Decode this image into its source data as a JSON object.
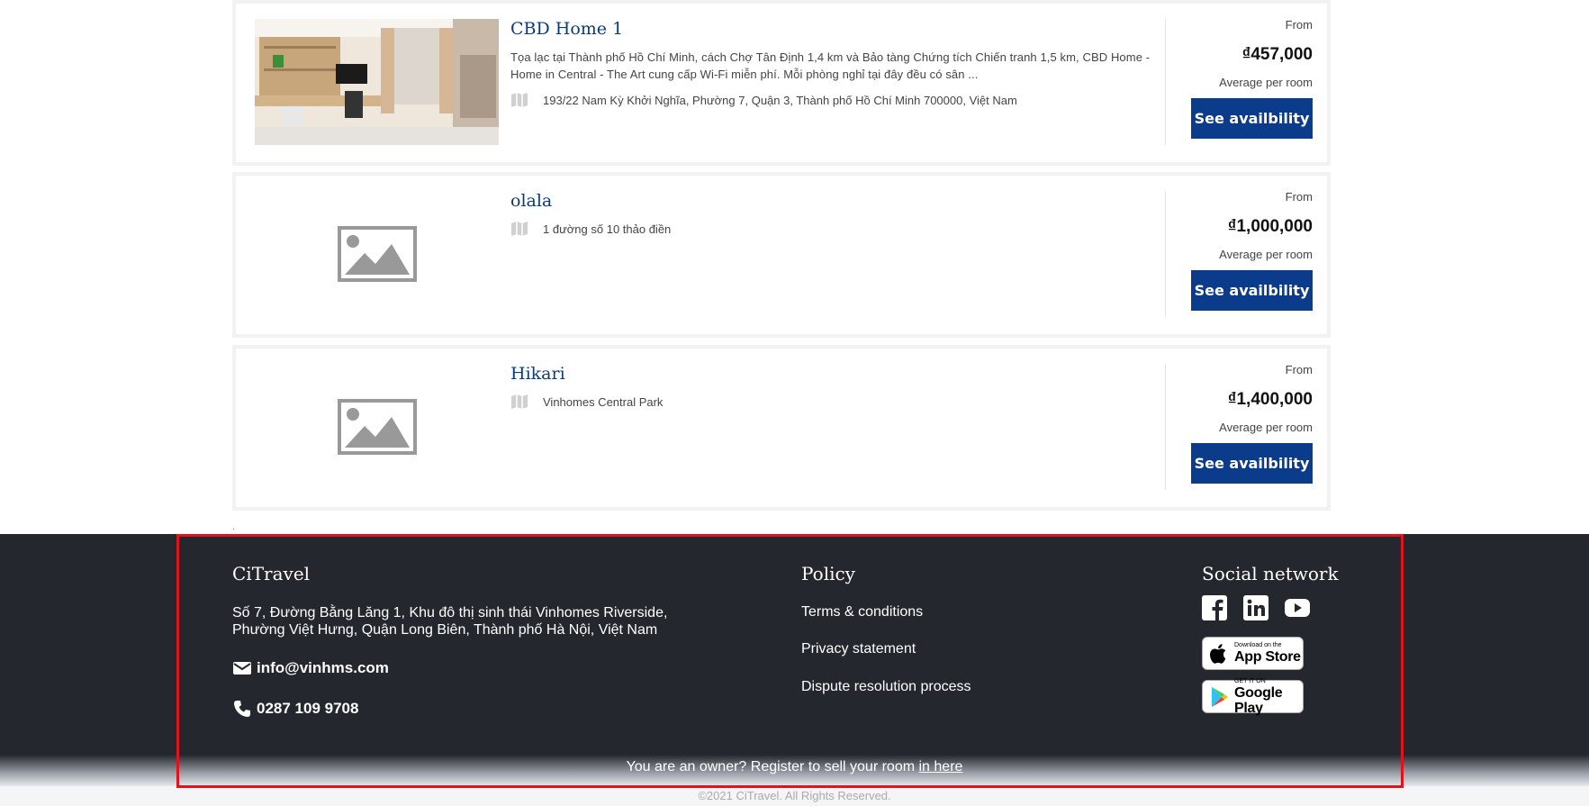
{
  "listings": [
    {
      "name": "CBD Home 1",
      "description": "Tọa lạc tại Thành phố Hồ Chí Minh, cách Chợ Tân Định 1,4 km và Bảo tàng Chứng tích Chiến tranh 1,5 km, CBD Home - Home in Central - The Art cung cấp Wi-Fi miễn phí. Mỗi phòng nghỉ tại đây đều có sân ...",
      "address": "193/22 Nam Kỳ Khởi Nghĩa, Phường 7, Quận 3, Thành phố Hồ Chí Minh 700000, Việt Nam",
      "from": "From",
      "price": "₫457,000",
      "avg": "Average per room",
      "button": "See availbility",
      "image": "room-photo"
    },
    {
      "name": "olala",
      "description": "",
      "address": "1 đường số 10 thảo điền",
      "from": "From",
      "price": "₫1,000,000",
      "avg": "Average per room",
      "button": "See availbility",
      "image": "placeholder-image-icon"
    },
    {
      "name": "Hikari",
      "description": "",
      "address": "Vinhomes Central Park",
      "from": "From",
      "price": "₫1,400,000",
      "avg": "Average per room",
      "button": "See availbility",
      "image": "placeholder-image-icon"
    }
  ],
  "stray_dot": ".",
  "footer": {
    "brand": "CiTravel",
    "address_line1": "Số 7, Đường Bằng Lăng 1, Khu đô thị sinh thái Vinhomes Riverside,",
    "address_line2": "Phường Việt Hưng, Quận Long Biên, Thành phố Hà Nội, Việt Nam",
    "email": "info@vinhms.com",
    "phone": "0287 109 9708",
    "policy_title": "Policy",
    "policy_links": [
      "Terms & conditions",
      "Privacy statement",
      "Dispute resolution process"
    ],
    "social_title": "Social network",
    "social_icons": [
      "facebook-icon",
      "linkedin-icon",
      "youtube-icon"
    ],
    "app_store_small": "Download on the",
    "app_store_large": "App Store",
    "google_play_small": "GET IT ON",
    "google_play_large": "Google Play",
    "register_text": "You are an owner? Register to sell your room ",
    "register_link": "in here",
    "copyright": "©2021 CiTravel. All Rights Reserved."
  },
  "colors": {
    "accent": "#0b3c8c",
    "title_blue": "#0b3c7a",
    "footer_bg": "#24272d",
    "highlight_frame": "#e0141c"
  }
}
